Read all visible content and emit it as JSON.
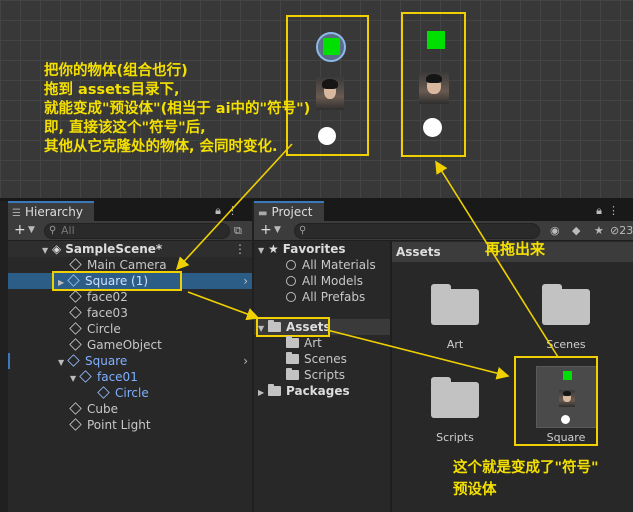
{
  "annotations": {
    "main_note": [
      "把你的物体(组合也行)",
      "拖到 assets目录下,",
      "就能变成\"预设体\"(相当于 ai中的\"符号\")",
      "即, 直接该这个\"符号\"后,",
      "其他从它克隆处的物体, 会同时变化."
    ],
    "drag_out_note": "再拖出来",
    "prefab_note": [
      "这个就是变成了\"符号\"",
      "预设体"
    ]
  },
  "hierarchy": {
    "tab_label": "Hierarchy",
    "search_placeholder": "All",
    "scene_name": "SampleScene*",
    "items": [
      {
        "label": "Main Camera"
      },
      {
        "label": "Square (1)"
      },
      {
        "label": "face02"
      },
      {
        "label": "face03"
      },
      {
        "label": "Circle"
      },
      {
        "label": "GameObject"
      },
      {
        "label": "Square"
      },
      {
        "label": "face01"
      },
      {
        "label": "Circle"
      },
      {
        "label": "Cube"
      },
      {
        "label": "Point Light"
      }
    ]
  },
  "project": {
    "tab_label": "Project",
    "hidden_count": "23",
    "favorites_label": "Favorites",
    "favorites": [
      "All Materials",
      "All Models",
      "All Prefabs"
    ],
    "assets_label": "Assets",
    "asset_folders": [
      "Art",
      "Scenes",
      "Scripts"
    ],
    "packages_label": "Packages",
    "breadcrumb": "Assets",
    "grid_items": [
      "Art",
      "Scenes",
      "Scripts",
      "Square"
    ]
  },
  "colors": {
    "annotation_yellow": "#f0d000",
    "selection_blue": "#2c5d87",
    "prefab_blue": "#7fb0ff",
    "sprite_green": "#00e000"
  }
}
